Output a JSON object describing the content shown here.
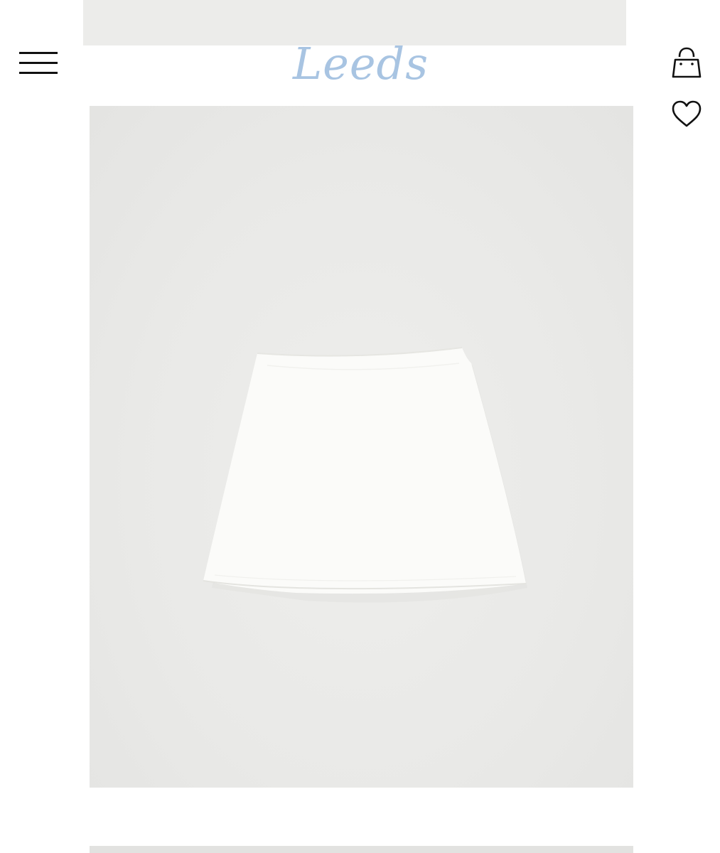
{
  "header": {
    "logo_text": "Leeds",
    "logo_color": "#a8c4e2",
    "menu_icon": "hamburger-menu-icon",
    "cart_icon": "shopping-bag-icon",
    "wishlist_icon": "heart-icon"
  },
  "gallery": {
    "background_color": "#e9e9e7",
    "product_color": "#fbfbf9"
  }
}
